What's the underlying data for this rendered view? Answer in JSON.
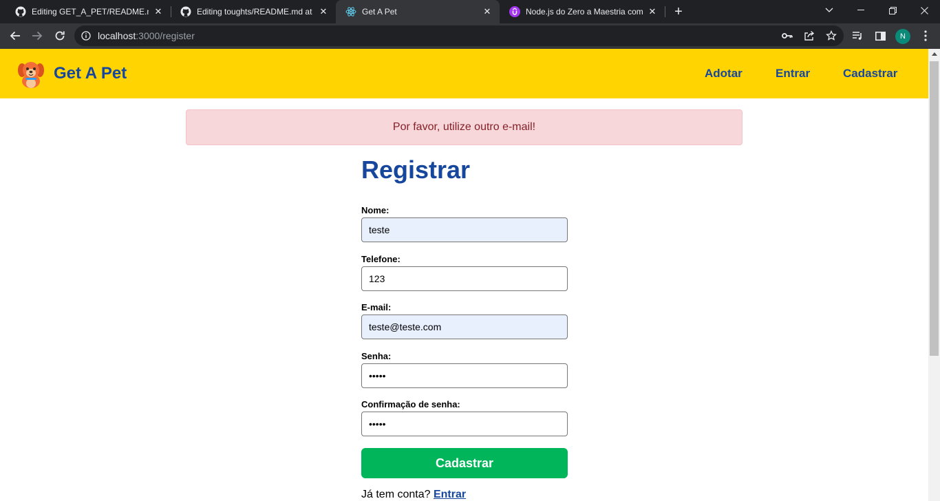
{
  "browser": {
    "tabs": [
      {
        "title": "Editing GET_A_PET/README.md at",
        "icon": "github-icon",
        "active": false
      },
      {
        "title": "Editing toughts/README.md at m",
        "icon": "github-icon",
        "active": false
      },
      {
        "title": "Get A Pet",
        "icon": "react-icon",
        "active": true
      },
      {
        "title": "Node.js do Zero a Maestria com",
        "icon": "udemy-icon",
        "active": false
      }
    ],
    "close_glyph": "✕",
    "new_tab_glyph": "+",
    "url_host": "localhost",
    "url_path": ":3000/register",
    "profile_initial": "N"
  },
  "site": {
    "brand": "Get A Pet",
    "nav": {
      "adopt": "Adotar",
      "login": "Entrar",
      "register": "Cadastrar"
    },
    "accent_color": "#ffd400",
    "brand_color": "#16479d"
  },
  "flash": {
    "message": "Por favor, utilize outro e-mail!"
  },
  "form": {
    "title": "Registrar",
    "fields": {
      "name": {
        "label": "Nome:",
        "value": "teste"
      },
      "phone": {
        "label": "Telefone:",
        "value": "123"
      },
      "email": {
        "label": "E-mail:",
        "value": "teste@teste.com"
      },
      "password": {
        "label": "Senha:",
        "value": "•••••"
      },
      "confirm": {
        "label": "Confirmação de senha:",
        "value": "•••••"
      }
    },
    "submit": "Cadastrar",
    "has_account_text": "Já tem conta?",
    "login_link": "Entrar",
    "submit_color": "#00b55a"
  }
}
